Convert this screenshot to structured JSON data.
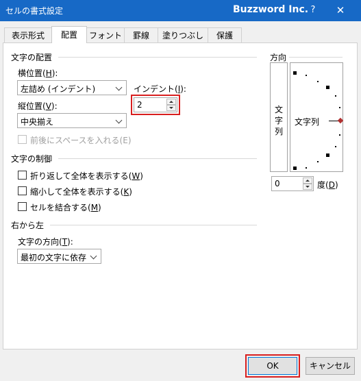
{
  "window": {
    "title": "セルの書式設定",
    "brand": "Buzzword Inc.",
    "help": "?",
    "close": "✕"
  },
  "tabs": [
    "表示形式",
    "配置",
    "フォント",
    "罫線",
    "塗りつぶし",
    "保護"
  ],
  "active_tab": "配置",
  "alignment": {
    "group": "文字の配置",
    "horizontal_label": "横位置(H):",
    "horizontal_value": "左詰め (インデント)",
    "indent_label": "インデント(I):",
    "indent_value": "2",
    "vertical_label": "縦位置(V):",
    "vertical_value": "中央揃え",
    "distributed_label": "前後にスペースを入れる(E)"
  },
  "control": {
    "group": "文字の制御",
    "wrap_label": "折り返して全体を表示する(W)",
    "shrink_label": "縮小して全体を表示する(K)",
    "merge_label": "セルを結合する(M)"
  },
  "rtl": {
    "group": "右から左",
    "direction_label": "文字の方向(T):",
    "direction_value": "最初の文字に依存"
  },
  "orientation": {
    "group": "方向",
    "vertical_text": [
      "文",
      "字",
      "列"
    ],
    "dial_text": "文字列",
    "degrees_value": "0",
    "degrees_label": "度(D)"
  },
  "buttons": {
    "ok": "OK",
    "cancel": "キャンセル"
  },
  "colors": {
    "titlebar": "#1769c6",
    "highlight": "#d81e1e"
  }
}
